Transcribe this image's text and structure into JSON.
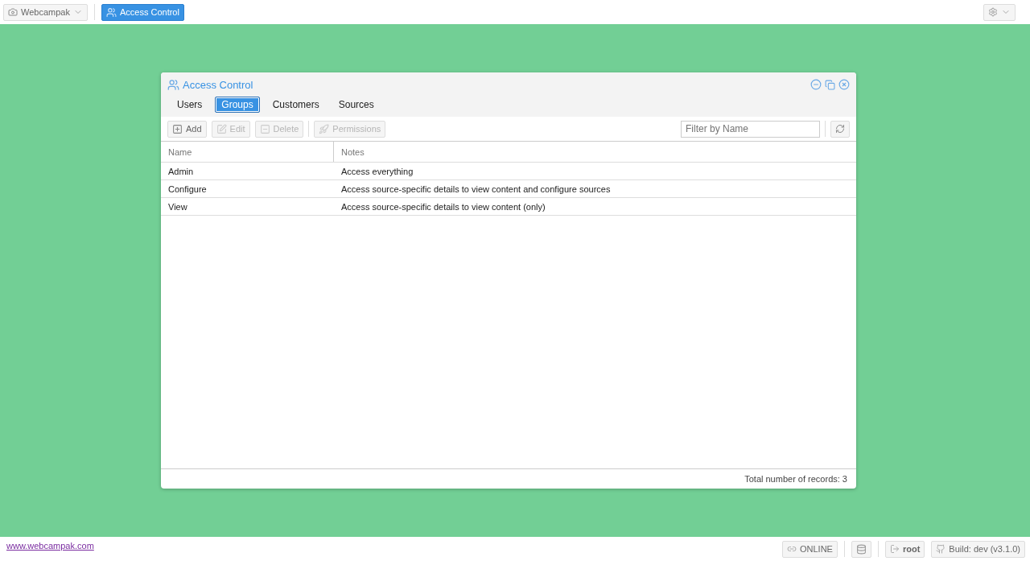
{
  "top_bar": {
    "app_menu": {
      "label": "Webcampak"
    },
    "tasks": [
      {
        "label": "Access Control",
        "selected": true
      }
    ]
  },
  "window": {
    "title": "Access Control",
    "tabs": [
      {
        "label": "Users",
        "selected": false
      },
      {
        "label": "Groups",
        "selected": true
      },
      {
        "label": "Customers",
        "selected": false
      },
      {
        "label": "Sources",
        "selected": false
      }
    ],
    "toolbar": [
      {
        "kind": "add",
        "label": "Add",
        "disabled": false
      },
      {
        "kind": "edit",
        "label": "Edit",
        "disabled": true
      },
      {
        "kind": "delete",
        "label": "Delete",
        "disabled": true
      },
      {
        "kind": "permissions",
        "label": "Permissions",
        "disabled": true
      }
    ],
    "filter": {
      "placeholder": "Filter by Name"
    },
    "table": {
      "columns": [
        "Name",
        "Notes"
      ],
      "rows": [
        {
          "name": "Admin",
          "notes": "Access everything"
        },
        {
          "name": "Configure",
          "notes": "Access source-specific details to view content and configure sources"
        },
        {
          "name": "View",
          "notes": "Access source-specific details to view content (only)"
        }
      ]
    },
    "footer": "Total number of records: 3"
  },
  "bottom_bar": {
    "link": "www.webcampak.com",
    "status": "ONLINE",
    "user": "root",
    "build": "Build: dev (v3.1.0)"
  }
}
